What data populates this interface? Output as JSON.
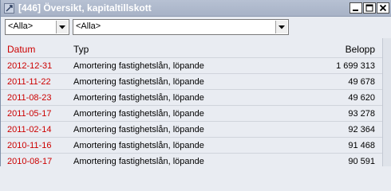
{
  "window": {
    "title": "[446] Översikt, kapitaltillskott",
    "icon": "app-icon",
    "controls": [
      "minimize-icon",
      "maximize-icon",
      "close-icon"
    ]
  },
  "filters": {
    "filter1": "<Alla>",
    "filter2": "<Alla>"
  },
  "table": {
    "columns": {
      "date": "Datum",
      "type": "Typ",
      "amount": "Belopp"
    },
    "rows": [
      {
        "date": "2012-12-31",
        "type": "Amortering fastighetslån, löpande",
        "amount": "1 699 313"
      },
      {
        "date": "2011-11-22",
        "type": "Amortering fastighetslån, löpande",
        "amount": "49 678"
      },
      {
        "date": "2011-08-23",
        "type": "Amortering fastighetslån, löpande",
        "amount": "49 620"
      },
      {
        "date": "2011-05-17",
        "type": "Amortering fastighetslån, löpande",
        "amount": "93 278"
      },
      {
        "date": "2011-02-14",
        "type": "Amortering fastighetslån, löpande",
        "amount": "92 364"
      },
      {
        "date": "2010-11-16",
        "type": "Amortering fastighetslån, löpande",
        "amount": "91 468"
      },
      {
        "date": "2010-08-17",
        "type": "Amortering fastighetslån, löpande",
        "amount": "90 591"
      }
    ]
  },
  "colors": {
    "date_text": "#cc0000",
    "title_bar": "#a7b2c6",
    "background": "#e9ecf2"
  }
}
